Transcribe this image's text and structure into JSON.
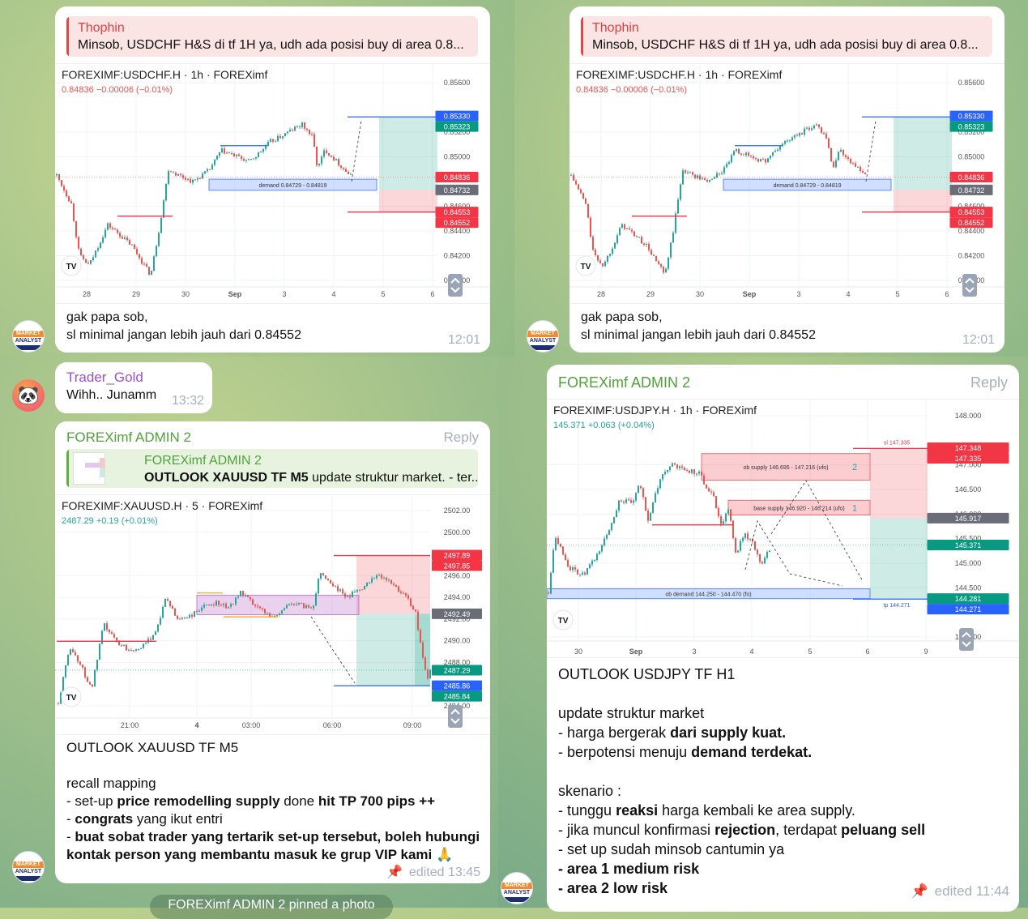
{
  "colors": {
    "up": "#26a69a",
    "down": "#ef5350",
    "sender_green": "#4fa33a",
    "reply_red": "#e0413f",
    "trader_purple": "#9b4fd6",
    "tag_blue": "#2962ff",
    "tag_green": "#089981",
    "tag_red": "#f23645",
    "tag_gray": "#6a6d78"
  },
  "avatar": {
    "top": "MARKET",
    "bottom": "ANALYST"
  },
  "panels": [
    {
      "reply": {
        "author": "Thophin",
        "text": "Minsob, USDCHF H&S di tf 1H ya, udh ada posisi buy di area 0.8..."
      },
      "chart": {
        "symbol_line": "FOREXIMF:USDCHF.H · 1h · FOREXimf",
        "quote": "0.84836  −0.00006 (−0.01%)",
        "quote_color": "#ef5350",
        "y_ticks": [
          "0.85600",
          "0.85200",
          "0.85000",
          "0.84600",
          "0.84400",
          "0.84200",
          "0.84000"
        ],
        "x_ticks": [
          "28",
          "29",
          "30",
          "Sep",
          "3",
          "4",
          "5",
          "6"
        ],
        "price_tags": [
          {
            "value": "0.85330",
            "color": "#2962ff"
          },
          {
            "value": "0.85323",
            "color": "#089981"
          },
          {
            "value": "0.84836",
            "color": "#f23645"
          },
          {
            "value": "0.84732",
            "color": "#6a6d78"
          },
          {
            "value": "0.84553",
            "color": "#f23645"
          },
          {
            "value": "0.84552",
            "color": "#f23645"
          }
        ],
        "annotations": [
          "demand 0.84729 - 0.84819"
        ]
      },
      "caption": [
        "gak papa sob,",
        "sl minimal jangan lebih jauh dari 0.84552"
      ],
      "time": "12:01"
    },
    {
      "reply": {
        "author": "Thophin",
        "text": "Minsob, USDCHF H&S di tf 1H ya, udh ada posisi buy di area 0.8..."
      },
      "chart": {
        "symbol_line": "FOREXIMF:USDCHF.H · 1h · FOREXimf",
        "quote": "0.84836  −0.00006 (−0.01%)",
        "quote_color": "#ef5350",
        "y_ticks": [
          "0.85600",
          "0.85200",
          "0.85000",
          "0.84600",
          "0.84400",
          "0.84200",
          "0.84000"
        ],
        "x_ticks": [
          "28",
          "29",
          "30",
          "Sep",
          "3",
          "4",
          "5",
          "6"
        ],
        "price_tags": [
          {
            "value": "0.85330",
            "color": "#2962ff"
          },
          {
            "value": "0.85323",
            "color": "#089981"
          },
          {
            "value": "0.84836",
            "color": "#f23645"
          },
          {
            "value": "0.84732",
            "color": "#6a6d78"
          },
          {
            "value": "0.84553",
            "color": "#f23645"
          },
          {
            "value": "0.84552",
            "color": "#f23645"
          }
        ],
        "annotations": [
          "demand 0.84729 - 0.84819"
        ]
      },
      "caption": [
        "gak papa sob,",
        "sl minimal jangan lebih jauh dari 0.84552"
      ],
      "time": "12:01"
    },
    {
      "trader_msg": {
        "author": "Trader_Gold",
        "text": "Wihh.. Junamm",
        "time": "13:32"
      },
      "sender": "FOREXimf ADMIN 2",
      "reply_label": "Reply",
      "reply": {
        "author": "FOREXimf ADMIN 2",
        "text_bold": "OUTLOOK XAUUSD TF M5",
        "text": "  update struktur market. - ter..."
      },
      "chart": {
        "symbol_line": "FOREXIMF:XAUUSD.H · 5 · FOREXimf",
        "quote": "2487.29  +0.19 (+0.01%)",
        "quote_color": "#26a69a",
        "y_ticks": [
          "2502.00",
          "2500.00",
          "2496.00",
          "2494.00",
          "2492.00",
          "2490.00",
          "2488.00",
          "2484.00"
        ],
        "x_ticks": [
          "21:00",
          "4",
          "03:00",
          "06:00",
          "09:00"
        ],
        "price_tags": [
          {
            "value": "2497.89",
            "color": "#f23645"
          },
          {
            "value": "2497.85",
            "color": "#f23645"
          },
          {
            "value": "2492.49",
            "color": "#6a6d78"
          },
          {
            "value": "2487.29",
            "color": "#089981"
          },
          {
            "value": "2485.86",
            "color": "#2962ff"
          },
          {
            "value": "2485.84",
            "color": "#089981"
          }
        ],
        "annotations": []
      },
      "message": [
        [
          {
            "t": "OUTLOOK XAUUSD TF M5",
            "b": false
          }
        ],
        [],
        [
          {
            "t": "recall mapping",
            "b": false
          }
        ],
        [
          {
            "t": "- set-up ",
            "b": false
          },
          {
            "t": "price remodelling supply",
            "b": true
          },
          {
            "t": " done ",
            "b": false
          },
          {
            "t": "hit TP 700 pips ++",
            "b": true
          }
        ],
        [
          {
            "t": "- ",
            "b": false
          },
          {
            "t": "congrats",
            "b": true
          },
          {
            "t": " yang ikut entri",
            "b": false
          }
        ],
        [
          {
            "t": "- ",
            "b": false
          },
          {
            "t": "buat sobat trader yang tertarik set-up tersebut, boleh hubungi",
            "b": true
          }
        ],
        [
          {
            "t": "kontak person yang membantu masuk ke grup VIP kami 🙏",
            "b": true
          }
        ]
      ],
      "edited": "edited 13:45",
      "pinned_notice": "FOREXimf ADMIN 2 pinned a photo"
    },
    {
      "sender": "FOREXimf ADMIN 2",
      "reply_label": "Reply",
      "chart": {
        "symbol_line": "FOREXIMF:USDJPY.H · 1h · FOREXimf",
        "quote": "145.371  +0.063 (+0.04%)",
        "quote_color": "#26a69a",
        "y_ticks": [
          "148.000",
          "147.000",
          "146.500",
          "146.000",
          "145.500",
          "145.000",
          "144.500",
          "143.500"
        ],
        "x_ticks": [
          "30",
          "Sep",
          "3",
          "4",
          "5",
          "6",
          "9"
        ],
        "price_tags": [
          {
            "value": "147.348",
            "color": "#f23645"
          },
          {
            "value": "147.335",
            "color": "#f23645"
          },
          {
            "value": "145.917",
            "color": "#6a6d78"
          },
          {
            "value": "145.371",
            "color": "#089981"
          },
          {
            "value": "144.281",
            "color": "#089981"
          },
          {
            "value": "144.271",
            "color": "#2962ff"
          }
        ],
        "annotations": [
          "ob supply 146.695 - 147.216 (ufo)",
          "2",
          "base supply 146.920 - 146.214 (ufo)",
          "1",
          "ob demand 144.250 - 144.470 (fo)",
          "sl 147.335",
          "tp 144.271"
        ]
      },
      "message": [
        [
          {
            "t": "OUTLOOK USDJPY TF H1",
            "b": false
          }
        ],
        [],
        [
          {
            "t": "update struktur market",
            "b": false
          }
        ],
        [
          {
            "t": "- harga bergerak ",
            "b": false
          },
          {
            "t": "dari supply kuat.",
            "b": true
          }
        ],
        [
          {
            "t": "- berpotensi menuju ",
            "b": false
          },
          {
            "t": "demand terdekat.",
            "b": true
          }
        ],
        [],
        [
          {
            "t": "skenario :",
            "b": false
          }
        ],
        [
          {
            "t": "- tunggu ",
            "b": false
          },
          {
            "t": "reaksi",
            "b": true
          },
          {
            "t": " harga kembali ke area supply.",
            "b": false
          }
        ],
        [
          {
            "t": "- jika muncul konfirmasi ",
            "b": false
          },
          {
            "t": "rejection",
            "b": true
          },
          {
            "t": ", terdapat ",
            "b": false
          },
          {
            "t": "peluang sell",
            "b": true
          }
        ],
        [
          {
            "t": "- set up sudah minsob cantumin ya",
            "b": false
          }
        ],
        [
          {
            "t": "- area 1 medium risk",
            "b": true
          }
        ],
        [
          {
            "t": "- area 2 low risk",
            "b": true
          }
        ]
      ],
      "edited": "edited 11:44"
    }
  ]
}
